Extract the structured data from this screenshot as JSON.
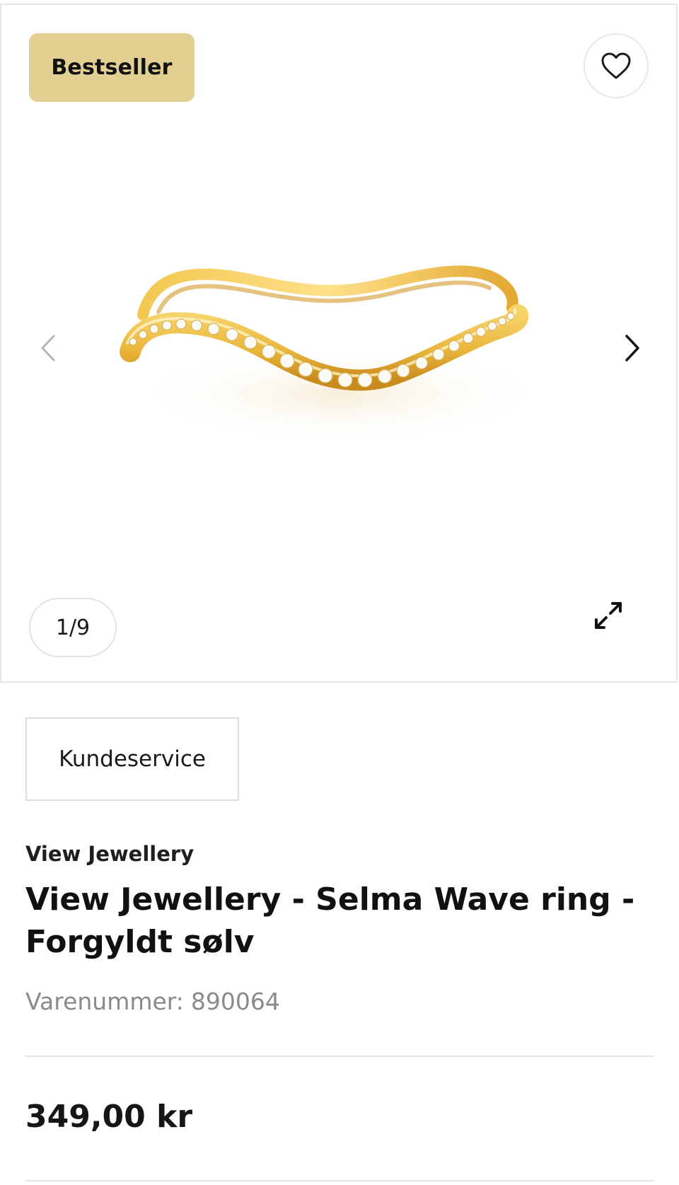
{
  "gallery": {
    "badge": "Bestseller",
    "counter": "1/9",
    "icons": {
      "favorite": "heart-icon",
      "previous": "chevron-left-icon",
      "next": "chevron-right-icon",
      "expand": "expand-icon"
    },
    "colors": {
      "badge_bg": "#e2cf92",
      "ring_gold": "#e9b53a"
    }
  },
  "customer_service": {
    "label": "Kundeservice"
  },
  "product": {
    "brand": "View Jewellery",
    "title": "View Jewellery - Selma Wave ring - Forgyldt sølv",
    "sku_label": "Varenummer:",
    "sku_value": "890064",
    "price": "349,00 kr"
  }
}
